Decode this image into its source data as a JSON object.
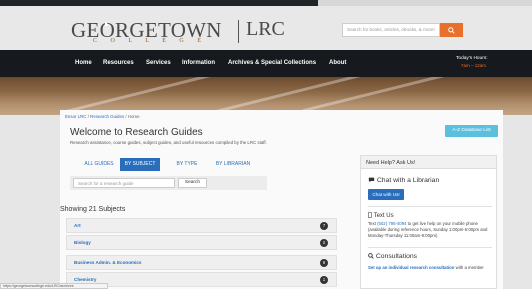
{
  "header": {
    "logo_word": "GEORGETOWN",
    "logo_college": "C O L L E G E",
    "logo_lrc": "LRC",
    "search_placeholder": "Search for books, articles, ebooks, & more!",
    "search_icon": "search-icon"
  },
  "nav": {
    "items": [
      "Home",
      "Resources",
      "Services",
      "Information",
      "Archives & Special Collections",
      "About"
    ],
    "hours_label": "Today's Hours:",
    "hours_value": "7am – 12am"
  },
  "breadcrumb": {
    "items": [
      "Ensor LRC",
      "Research Guides",
      "Home"
    ]
  },
  "page": {
    "title": "Welcome to Research Guides",
    "subtitle": "Research assistance, course guides, subject guides, and useful resources compiled by the LRC staff.",
    "az_button": "A-Z Database List"
  },
  "tabs": [
    {
      "label": "ALL GUIDES",
      "active": false
    },
    {
      "label": "BY SUBJECT",
      "active": true
    },
    {
      "label": "BY TYPE",
      "active": false
    },
    {
      "label": "BY LIBRARIAN",
      "active": false
    }
  ],
  "guide_search": {
    "placeholder": "Search for a research guide",
    "button": "Search"
  },
  "subjects": {
    "heading": "Showing 21 Subjects",
    "rows": [
      {
        "name": "Art",
        "count": "7"
      },
      {
        "name": "Biology",
        "count": "2"
      },
      {
        "name": "Business Admin. & Economics",
        "count": "6"
      },
      {
        "name": "Chemistry",
        "count": "1"
      }
    ]
  },
  "sidebar": {
    "heading": "Need Help? Ask Us!",
    "chat_title": "Chat with a Librarian",
    "chat_button": "Chat with Us!",
    "text_title": "Text Us",
    "text_body_pre": "Text",
    "text_number": "(502) 795-4094",
    "text_body_post": "to get live help on your mobile phone (available during reference hours, Sunday 1:00pm-6:00pm and Monday-Thursday 11:00am-9:00pm)",
    "consult_title": "Consultations",
    "consult_link": "Set up an individual research consultation",
    "consult_rest": "with a member"
  },
  "status_bar": {
    "url": "https://georgetowncollege.edu/LRC/archives"
  }
}
